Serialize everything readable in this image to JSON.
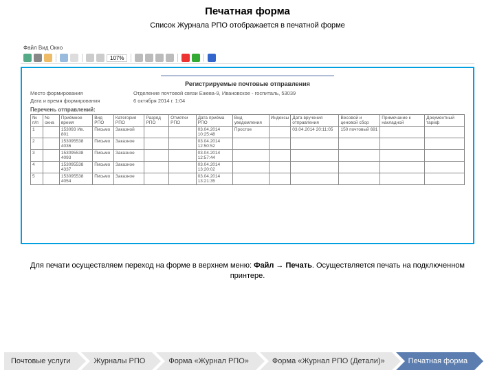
{
  "heading": "Печатная форма",
  "subtitle": "Список Журнала РПО отображается в печатной форме",
  "menubar": "Файл   Вид   Окно",
  "zoom": "107%",
  "doc": {
    "title": "Регистрируемые почтовые отправления",
    "meta1_label": "Место формирования",
    "meta1_value": "Отделение почтовой связи Ежева-9, Ивановское - госпиталь, 53039",
    "meta2_label": "Дата и время формирования",
    "meta2_value": "6 октября 2014 г. 1:04",
    "list_label": "Перечень отправлений:",
    "columns": [
      "№ п/п",
      "№ окна",
      "Приёмное время",
      "Вид РПО",
      "Категория РПО",
      "Разряд РПО",
      "Отметки РПО",
      "Дата приёма РПО",
      "Вид уведомления",
      "Индексы",
      "Дата вручения отправления",
      "Весовой и ценовой сбор",
      "Примечание к накладной",
      "Документный тариф"
    ],
    "rows": [
      {
        "n": "1",
        "barcode": "153093 Ив. 801",
        "vid": "Письмо",
        "kat": "Заказной",
        "date": "03.04.2014 10:25:48",
        "uved": "Простое",
        "dvru": "03.04.2014 20:11:05",
        "sbor": "150 почтовый 691"
      },
      {
        "n": "2",
        "barcode": "153095538 4036",
        "vid": "Письмо",
        "kat": "Заказное",
        "date": "03.04.2014 12:50:52"
      },
      {
        "n": "3",
        "barcode": "153095538 4093",
        "vid": "Письмо",
        "kat": "Заказное",
        "date": "03.04.2014 12:57:44"
      },
      {
        "n": "4",
        "barcode": "153095538 4337",
        "vid": "Письмо",
        "kat": "Заказное",
        "date": "03.04.2014 13:20:02"
      },
      {
        "n": "5",
        "barcode": "153095538 4054",
        "vid": "Письмо",
        "kat": "Заказное",
        "date": "03.04.2014 13:21:35"
      }
    ]
  },
  "caption_pre": "Для печати осуществляем переход на форме в верхнем меню: ",
  "caption_b1": "Файл",
  "caption_arrow": " → ",
  "caption_b2": "Печать",
  "caption_post": ". Осуществляется печать на подключенном принтере.",
  "crumbs": [
    "Почтовые услуги",
    "Журналы РПО",
    "Форма «Журнал РПО»",
    "Форма «Журнал РПО (Детали)»",
    "Печатная форма"
  ]
}
